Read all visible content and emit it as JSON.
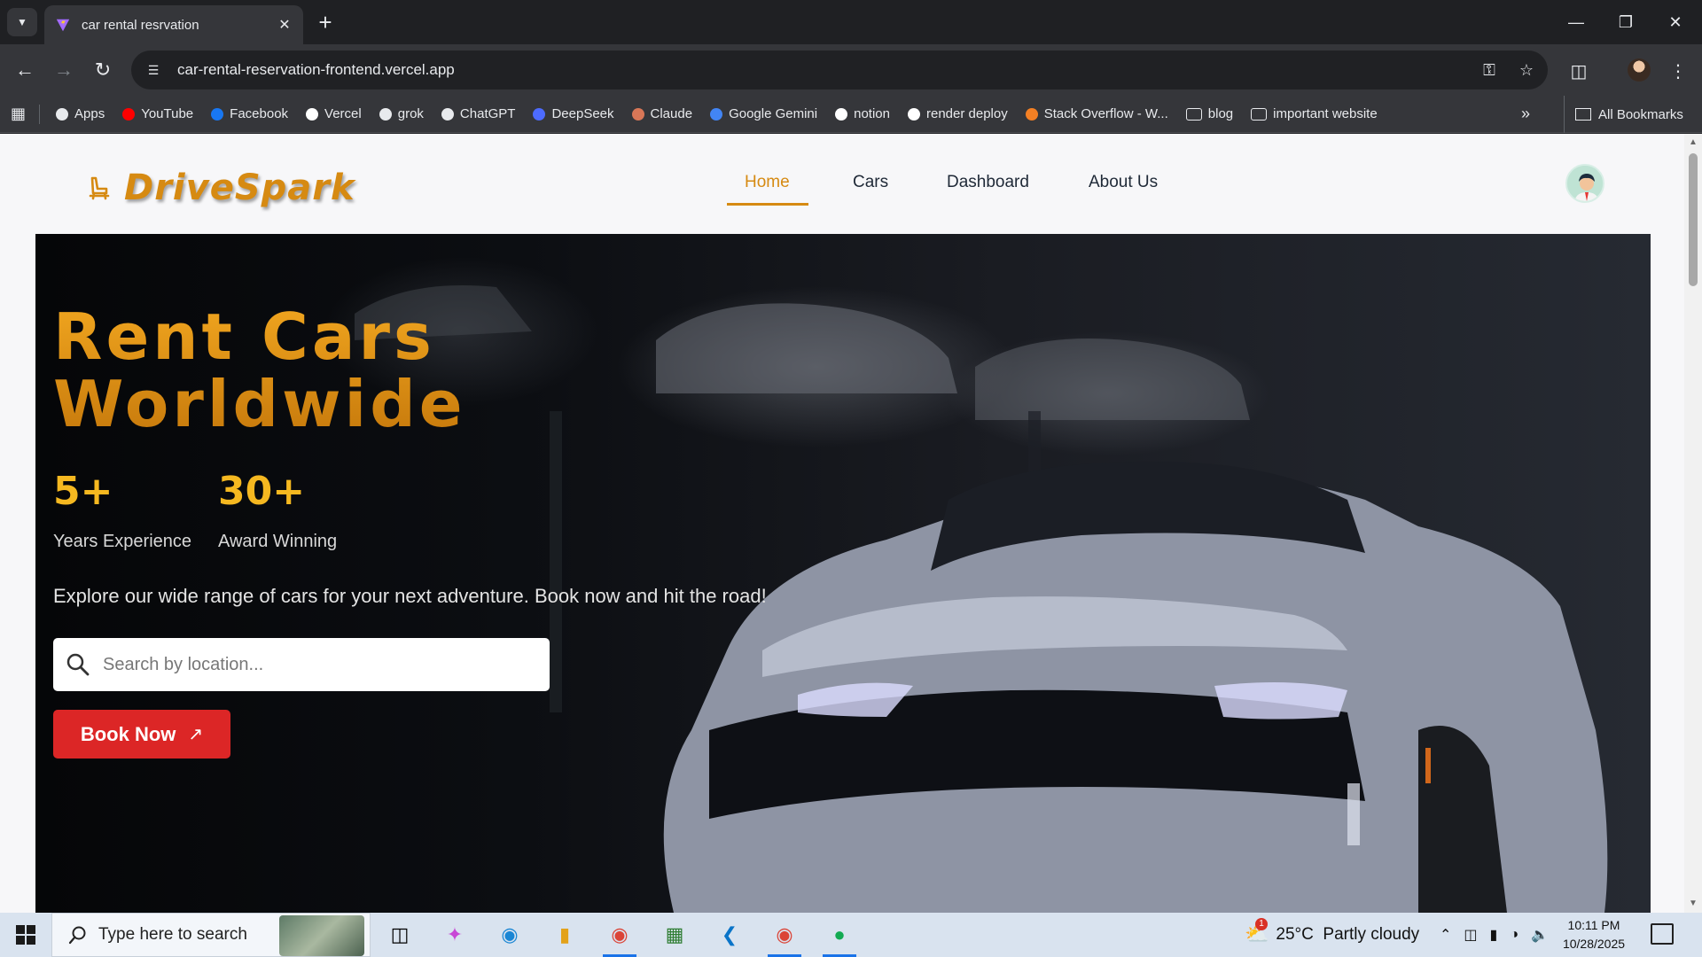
{
  "browser": {
    "tab_title": "car rental resrvation",
    "url": "car-rental-reservation-frontend.vercel.app",
    "bookmarks": [
      {
        "label": "Apps",
        "icon": "apps-grid-icon",
        "color": "#e8eaed"
      },
      {
        "label": "YouTube",
        "icon": "youtube-icon",
        "color": "#ff0000"
      },
      {
        "label": "Facebook",
        "icon": "facebook-icon",
        "color": "#1877f2"
      },
      {
        "label": "Vercel",
        "icon": "vercel-icon",
        "color": "#ffffff"
      },
      {
        "label": "grok",
        "icon": "grok-icon",
        "color": "#e8eaed"
      },
      {
        "label": "ChatGPT",
        "icon": "chatgpt-icon",
        "color": "#e8eaed"
      },
      {
        "label": "DeepSeek",
        "icon": "deepseek-icon",
        "color": "#4d6bfe"
      },
      {
        "label": "Claude",
        "icon": "claude-icon",
        "color": "#d97757"
      },
      {
        "label": "Google Gemini",
        "icon": "gemini-icon",
        "color": "#4285f4"
      },
      {
        "label": "notion",
        "icon": "notion-icon",
        "color": "#ffffff"
      },
      {
        "label": "render deploy",
        "icon": "render-icon",
        "color": "#ffffff"
      },
      {
        "label": "Stack Overflow - W...",
        "icon": "stackoverflow-icon",
        "color": "#f48024"
      },
      {
        "label": "blog",
        "icon": "folder-icon",
        "color": "#e8eaed"
      },
      {
        "label": "important website",
        "icon": "folder-icon",
        "color": "#e8eaed"
      }
    ],
    "all_bookmarks": "All Bookmarks"
  },
  "site": {
    "brand": "DriveSpark",
    "nav": [
      "Home",
      "Cars",
      "Dashboard",
      "About Us"
    ],
    "active_nav": "Home",
    "accent_color": "#d68a12"
  },
  "hero": {
    "title_line1": "Rent Cars",
    "title_line2": "Worldwide",
    "stats": [
      {
        "value": "5+",
        "label": "Years Experience"
      },
      {
        "value": "30+",
        "label": "Award Winning"
      }
    ],
    "description": "Explore our wide range of cars for your next adventure. Book now and hit the road!",
    "search_placeholder": "Search by location...",
    "book_button": "Book Now"
  },
  "taskbar": {
    "search_placeholder": "Type here to search",
    "weather": "25°C  Partly cloudy",
    "weather_badge": "1",
    "time": "10:11 PM",
    "date": "10/28/2025"
  }
}
